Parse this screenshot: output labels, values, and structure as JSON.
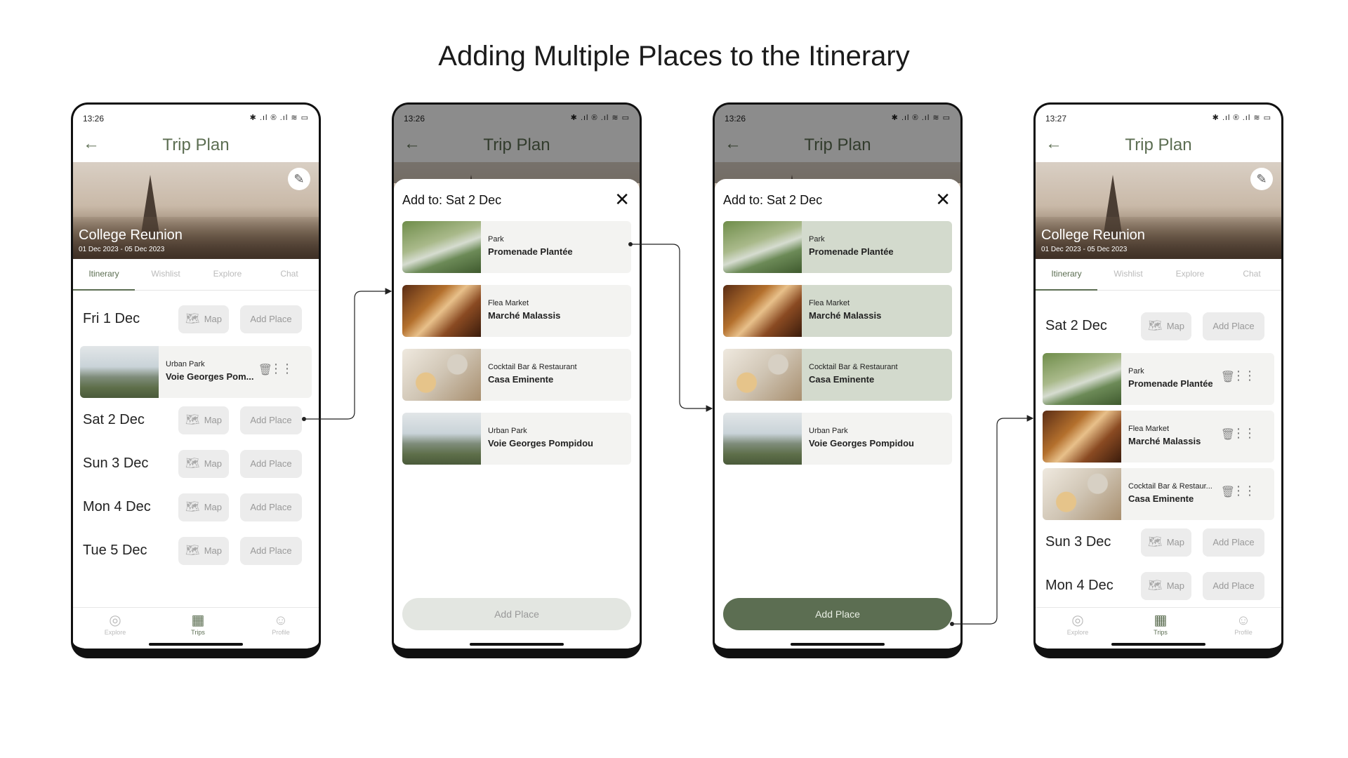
{
  "page_title": "Adding Multiple Places to the Itinerary",
  "colors": {
    "accent": "#5c6e52",
    "selected_card": "#d3dacd",
    "chip": "#ececec"
  },
  "common": {
    "status_icons": "✱ .ıl ® .ıl ≋ ▭",
    "header_title": "Trip Plan",
    "trip_name": "College Reunion",
    "trip_dates": "01 Dec 2023 - 05 Dec 2023",
    "tabs": [
      "Itinerary",
      "Wishlist",
      "Explore",
      "Chat"
    ],
    "map_label": "Map",
    "add_place_label": "Add Place",
    "nav": [
      "Explore",
      "Trips",
      "Profile"
    ]
  },
  "screen1": {
    "time": "13:26",
    "days": [
      "Fri 1 Dec",
      "Sat 2 Dec",
      "Sun 3 Dec",
      "Mon 4 Dec",
      "Tue 5 Dec"
    ],
    "place": {
      "category": "Urban Park",
      "name": "Voie Georges Pom..."
    }
  },
  "sheet": {
    "title": "Add to: Sat 2 Dec",
    "add_button": "Add Place",
    "options": [
      {
        "category": "Park",
        "name": "Promenade Plantée"
      },
      {
        "category": "Flea Market",
        "name": "Marché Malassis"
      },
      {
        "category": "Cocktail Bar & Restaurant",
        "name": "Casa Eminente"
      },
      {
        "category": "Urban Park",
        "name": "Voie Georges Pompidou"
      }
    ]
  },
  "screen2": {
    "time": "13:26"
  },
  "screen3": {
    "time": "13:26"
  },
  "screen4": {
    "time": "13:27",
    "days": [
      "Sat 2 Dec",
      "Sun 3 Dec",
      "Mon 4 Dec"
    ],
    "places": [
      {
        "category": "Park",
        "name": "Promenade Plantée"
      },
      {
        "category": "Flea Market",
        "name": "Marché Malassis"
      },
      {
        "category": "Cocktail Bar & Restaur...",
        "name": "Casa Eminente"
      }
    ]
  }
}
